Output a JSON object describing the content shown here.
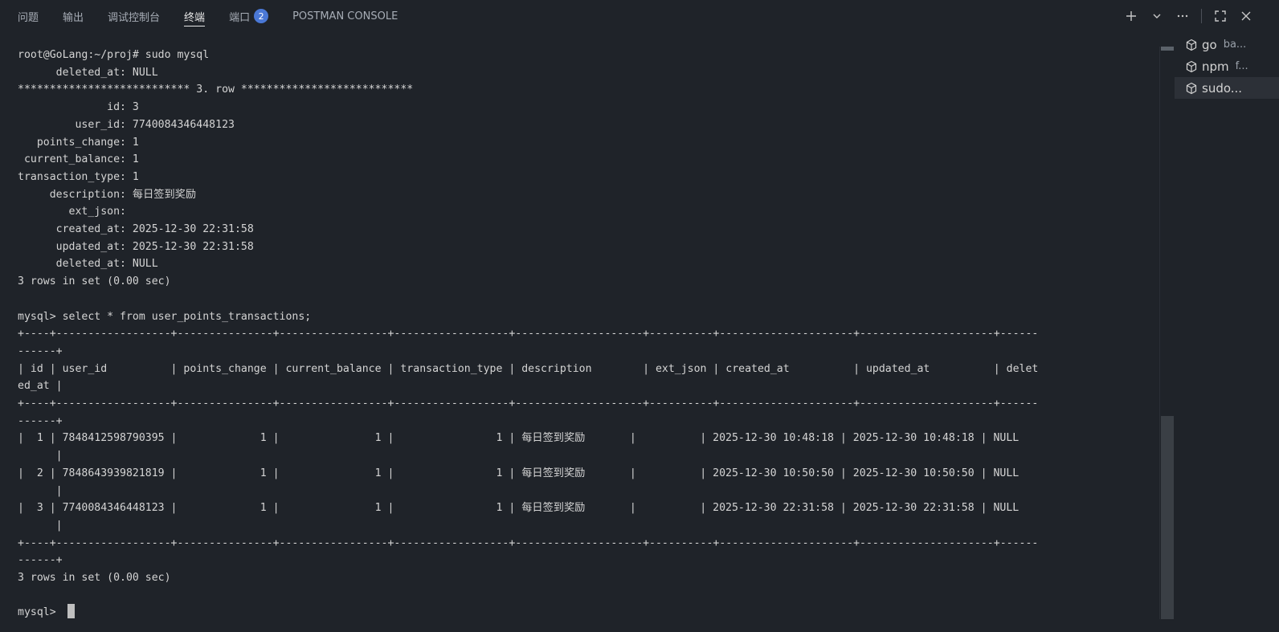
{
  "tabs": [
    {
      "label": "问题"
    },
    {
      "label": "输出"
    },
    {
      "label": "调试控制台"
    },
    {
      "label": "终端",
      "active": true
    },
    {
      "label": "端口",
      "badge": "2"
    },
    {
      "label": "POSTMAN CONSOLE"
    }
  ],
  "actions": {
    "plus_icon": "plus-icon",
    "chevron_icon": "chevron-down-icon",
    "more_icon": "more-icon",
    "maximize_icon": "maximize-icon",
    "close_icon": "close-icon"
  },
  "terminal": {
    "lines": [
      "root@GoLang:~/proj# sudo mysql",
      "      deleted_at: NULL",
      "*************************** 3. row ***************************",
      "              id: 3",
      "         user_id: 7740084346448123",
      "   points_change: 1",
      " current_balance: 1",
      "transaction_type: 1",
      "     description: 每日签到奖励",
      "        ext_json: ",
      "      created_at: 2025-12-30 22:31:58",
      "      updated_at: 2025-12-30 22:31:58",
      "      deleted_at: NULL",
      "3 rows in set (0.00 sec)",
      "",
      "mysql> select * from user_points_transactions;",
      "+----+------------------+---------------+-----------------+------------------+--------------------+----------+---------------------+---------------------+------",
      "------+",
      "| id | user_id          | points_change | current_balance | transaction_type | description        | ext_json | created_at          | updated_at          | delet",
      "ed_at |",
      "+----+------------------+---------------+-----------------+------------------+--------------------+----------+---------------------+---------------------+------",
      "------+",
      "|  1 | 7848412598790395 |             1 |               1 |                1 | 每日签到奖励       |          | 2025-12-30 10:48:18 | 2025-12-30 10:48:18 | NULL",
      "      |",
      "|  2 | 7848643939821819 |             1 |               1 |                1 | 每日签到奖励       |          | 2025-12-30 10:50:50 | 2025-12-30 10:50:50 | NULL",
      "      |",
      "|  3 | 7740084346448123 |             1 |               1 |                1 | 每日签到奖励       |          | 2025-12-30 22:31:58 | 2025-12-30 22:31:58 | NULL",
      "      |",
      "+----+------------------+---------------+-----------------+------------------+--------------------+----------+---------------------+---------------------+------",
      "------+",
      "3 rows in set (0.00 sec)",
      "",
      "mysql> "
    ]
  },
  "right_panel": {
    "items": [
      {
        "name": "go",
        "sub": "ba..."
      },
      {
        "name": "npm",
        "sub": "f..."
      },
      {
        "name": "sudo...",
        "sub": "",
        "selected": true
      }
    ]
  }
}
